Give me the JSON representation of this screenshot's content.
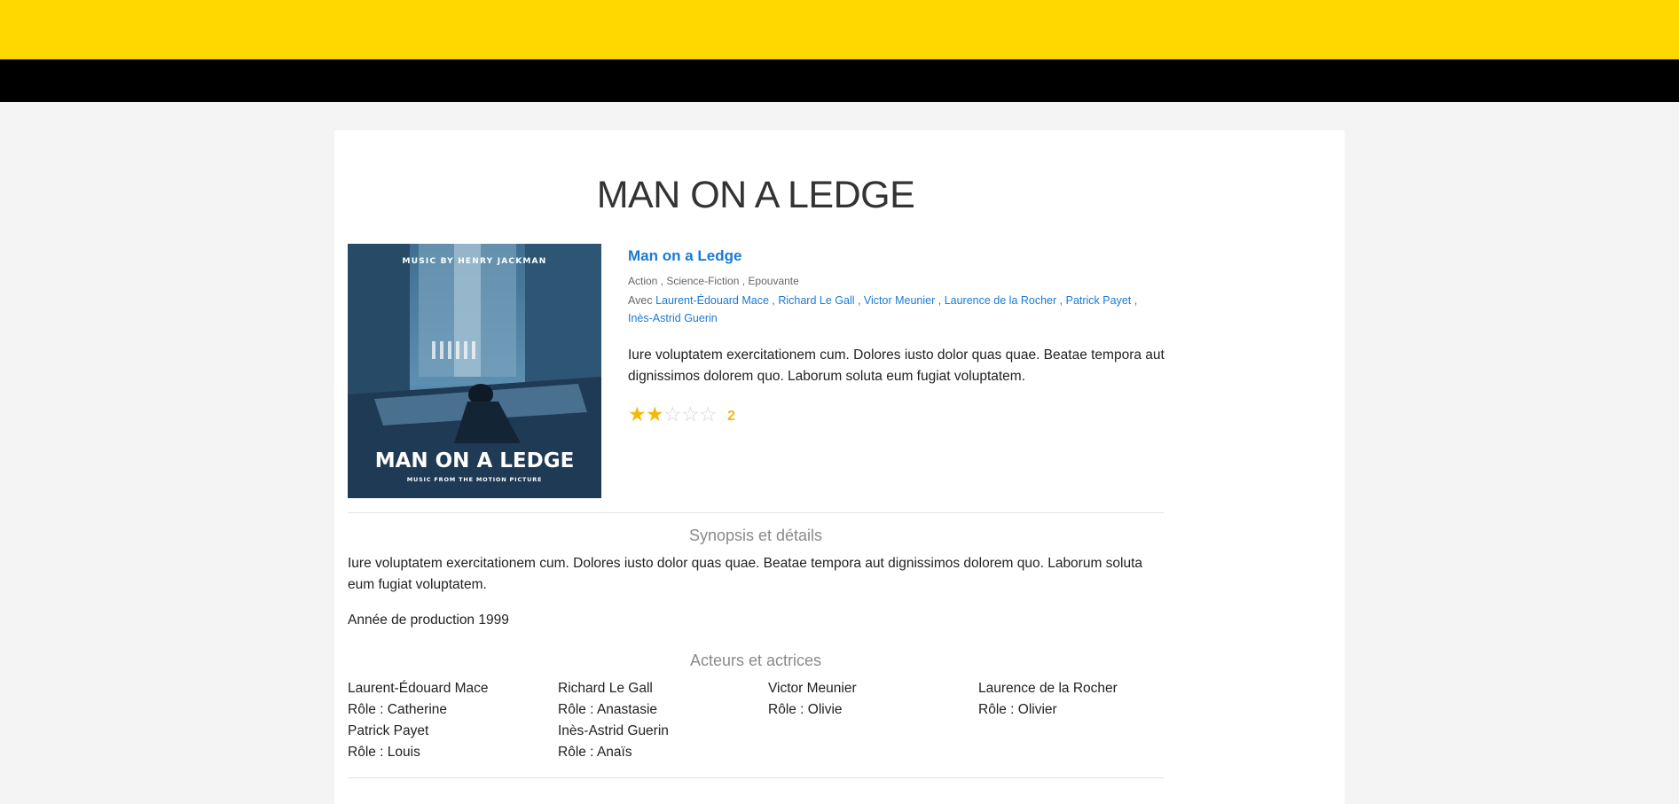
{
  "page": {
    "title": "MAN ON A LEDGE"
  },
  "movie": {
    "poster_top_text": "MUSIC BY HENRY JACKMAN",
    "poster_title": "MAN ON A LEDGE",
    "poster_subtitle": "MUSIC FROM THE MOTION PICTURE",
    "title_link": "Man on a Ledge",
    "genres": [
      "Action",
      "Science-Fiction",
      "Epouvante"
    ],
    "cast_prefix": "Avec",
    "cast": [
      "Laurent-Édouard Mace",
      "Richard Le Gall",
      "Victor Meunier",
      "Laurence de la Rocher",
      "Patrick Payet",
      "Inès-Astrid Guerin"
    ],
    "summary": "Iure voluptatem exercitationem cum. Dolores iusto dolor quas quae. Beatae tempora aut dignissimos dolorem quo. Laborum soluta eum fugiat voluptatem.",
    "rating": 2,
    "rating_max": 5,
    "rating_label": "2",
    "rating_color": "#f4b90c"
  },
  "synopsis": {
    "heading": "Synopsis et détails",
    "text": "Iure voluptatem exercitationem cum. Dolores iusto dolor quas quae. Beatae tempora aut dignissimos dolorem quo. Laborum soluta eum fugiat voluptatem.",
    "year_line": "Année de production 1999"
  },
  "actors": {
    "heading": "Acteurs et actrices",
    "list": [
      {
        "name": "Laurent-Édouard Mace",
        "role": "Rôle : Catherine"
      },
      {
        "name": "Richard Le Gall",
        "role": "Rôle : Anastasie"
      },
      {
        "name": "Victor Meunier",
        "role": "Rôle : Olivie"
      },
      {
        "name": "Laurence de la Rocher",
        "role": "Rôle : Olivier"
      },
      {
        "name": "Patrick Payet",
        "role": "Rôle : Louis"
      },
      {
        "name": "Inès-Astrid Guerin",
        "role": "Rôle : Anaïs"
      }
    ]
  },
  "colors": {
    "topbar": "#ffd800",
    "navbar": "#000000",
    "link": "#1a7ad4"
  }
}
